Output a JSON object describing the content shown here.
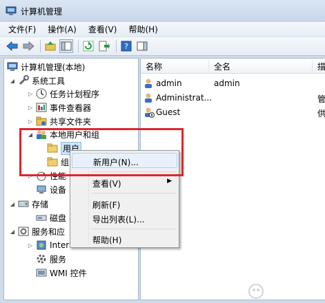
{
  "window": {
    "title": "计算机管理"
  },
  "menubar": {
    "items": [
      "文件(F)",
      "操作(A)",
      "查看(V)",
      "帮助(H)"
    ]
  },
  "toolbar": {
    "buttons": [
      "back-icon",
      "forward-icon",
      "up-folder-icon",
      "show-hide-tree-icon",
      "refresh-icon",
      "export-icon",
      "help-icon",
      "action-pane-icon"
    ]
  },
  "tree": {
    "root": "计算机管理(本地)",
    "system_tools": "系统工具",
    "task_scheduler": "任务计划程序",
    "event_viewer": "事件查看器",
    "shared_folders": "共享文件夹",
    "local_users_groups": "本地用户和组",
    "users": "用户",
    "groups_partial": "组",
    "performance_partial": "性能",
    "device_manager_partial": "设备",
    "storage": "存储",
    "disk_partial": "磁盘",
    "services_apps_partial": "服务和应",
    "internet_partial": "Inter",
    "services": "服务",
    "wmi": "WMI 控件"
  },
  "list": {
    "columns": [
      "名称",
      "全名",
      "描"
    ],
    "rows": [
      {
        "name": "admin",
        "fullname": "admin",
        "desc": ""
      },
      {
        "name": "Administrat...",
        "fullname": "",
        "desc": "管"
      },
      {
        "name": "Guest",
        "fullname": "",
        "desc": "供"
      }
    ]
  },
  "context_menu": {
    "new_user": "新用户(N)...",
    "view": "查看(V)",
    "refresh": "刷新(F)",
    "export": "导出列表(L)...",
    "help": "帮助(H)"
  },
  "watermark": "Baidu 经验",
  "colors": {
    "highlight_box": "#e0242b",
    "selection": "#cde3f7"
  }
}
